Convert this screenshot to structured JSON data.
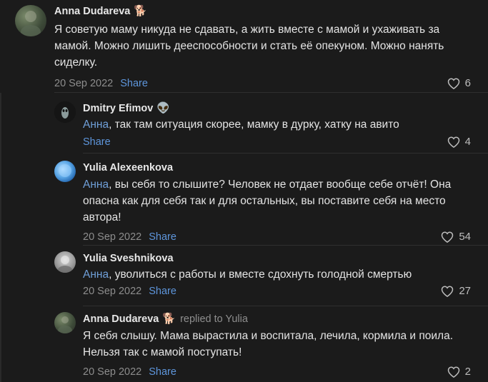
{
  "comments": [
    {
      "author": "Anna Dudareva",
      "emoji": "🐕",
      "replied_to": "",
      "mention": "",
      "text": "Я советую маму никуда не сдавать, а жить вместе с мамой и ухаживать за мамой. Можно лишить дееспособности и стать её опекуном. Можно нанять сиделку.",
      "date": "20 Sep 2022",
      "share": "Share",
      "likes": "6"
    },
    {
      "author": "Dmitry Efimov",
      "emoji": "👽",
      "replied_to": "",
      "mention": "Анна",
      "text": ", так там ситуация скорее, мамку в дурку, хатку на авито",
      "date": "",
      "share": "Share",
      "likes": "4"
    },
    {
      "author": "Yulia Alexeenkova",
      "emoji": "",
      "replied_to": "",
      "mention": "Анна",
      "text": ", вы себя то слышите? Человек не отдает вообще себе отчёт! Она опасна как для себя так и для остальных, вы поставите себя на место автора!",
      "date": "20 Sep 2022",
      "share": "Share",
      "likes": "54"
    },
    {
      "author": "Yulia Sveshnikova",
      "emoji": "",
      "replied_to": "",
      "mention": "Анна",
      "text": ", уволиться с работы и вместе сдохнуть голодной смертью",
      "date": "20 Sep 2022",
      "share": "Share",
      "likes": "27"
    },
    {
      "author": "Anna Dudareva",
      "emoji": "🐕",
      "replied_to": "replied to Yulia",
      "mention": "",
      "text": "Я себя слышу. Мама вырастила и воспитала, лечила, кормила и поила. Нельзя так с мамой поступать!",
      "date": "20 Sep 2022",
      "share": "Share",
      "likes": "2"
    }
  ],
  "colors": {
    "background": "#1b1b1b",
    "link": "#5e96dc",
    "mention": "#6f9fd8",
    "muted": "#8d8d8d"
  }
}
